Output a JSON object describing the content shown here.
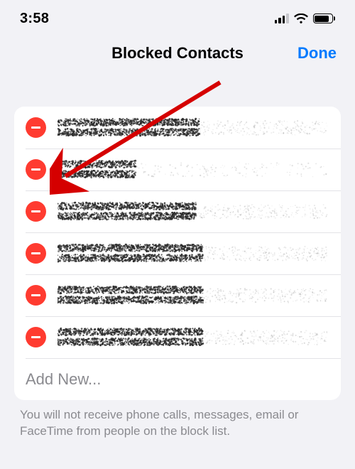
{
  "status": {
    "time": "3:58"
  },
  "nav": {
    "title": "Blocked Contacts",
    "done": "Done"
  },
  "list": {
    "contacts": [
      {
        "label": "[redacted]"
      },
      {
        "label": "[redacted]"
      },
      {
        "label": "[redacted]"
      },
      {
        "label": "[redacted]"
      },
      {
        "label": "[redacted]"
      },
      {
        "label": "[redacted]"
      }
    ],
    "add_label": "Add New..."
  },
  "footer": {
    "note": "You will not receive phone calls, messages, email or FaceTime from people on the block list."
  }
}
